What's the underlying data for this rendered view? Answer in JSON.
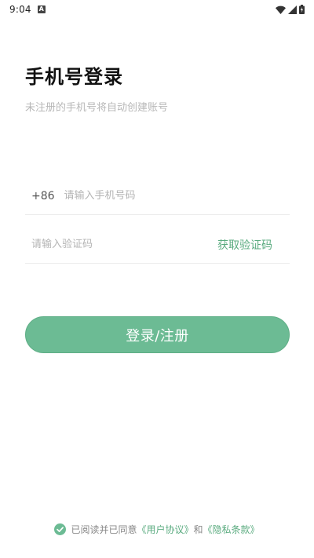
{
  "statusbar": {
    "time": "9:04",
    "notification_letter": "A"
  },
  "login": {
    "title": "手机号登录",
    "subtitle": "未注册的手机号将自动创建账号",
    "country_code": "+86",
    "phone_placeholder": "请输入手机号码",
    "code_placeholder": "请输入验证码",
    "get_code_label": "获取验证码",
    "submit_label": "登录/注册"
  },
  "agreement": {
    "checked": true,
    "prefix": "已阅读并已同意",
    "user_agreement": "《用户协议》",
    "conjunction": "和",
    "privacy_policy": "《隐私条款》"
  },
  "colors": {
    "accent": "#6cbb94",
    "link": "#5aab7f",
    "placeholder": "#b4b4b4"
  },
  "icons": {
    "status": [
      "wifi-icon",
      "signal-icon",
      "battery-icon"
    ],
    "agreement_check": "check-circle-icon"
  }
}
